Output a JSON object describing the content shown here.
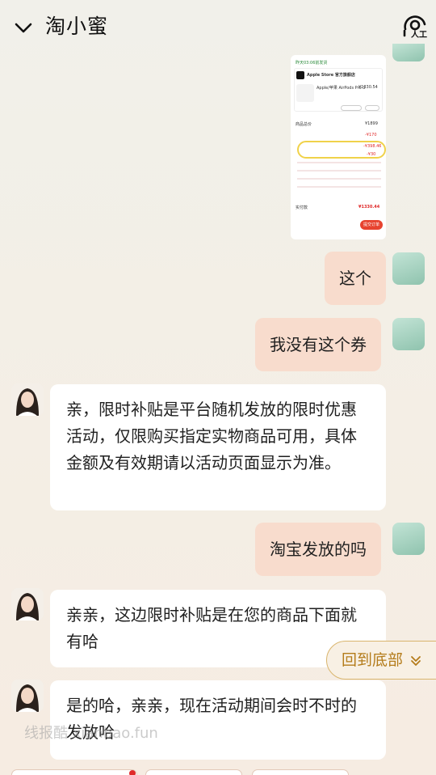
{
  "header": {
    "title": "淘小蜜",
    "agent_label": "人工"
  },
  "screenshot": {
    "status": "昨天03:06前发货",
    "store": "Apple Store 官方旗舰店",
    "product": "Apple/苹果 AirPods Pro 3",
    "product_price": "¥1330.54",
    "subtotal_label": "商品总价",
    "subtotal": "¥1899",
    "discount1": "-¥170",
    "discount2": "-¥398.46",
    "discount3": "-¥30",
    "pay_label": "实付款",
    "pay": "¥1330.44",
    "pay_button": "提交订单"
  },
  "messages": {
    "m1": "这个",
    "m2": "我没有这个券",
    "m3": "亲，限时补贴是平台随机发放的限时优惠活动，仅限购买指定实物商品可用，具体金额及有效期请以活动页面显示为准。",
    "m4": "淘宝发放的吗",
    "m5": "亲亲，这边限时补贴是在您的商品下面就有哈",
    "m6": "是的哈，亲亲，现在活动期间会时不时的发放哈"
  },
  "back_to_bottom": "回到底部",
  "watermark": "线报酷 xianbao.fun",
  "colors": {
    "user_bubble": "#f8dccd",
    "agent_bubble": "#ffffff",
    "accent": "#b47c1b"
  }
}
